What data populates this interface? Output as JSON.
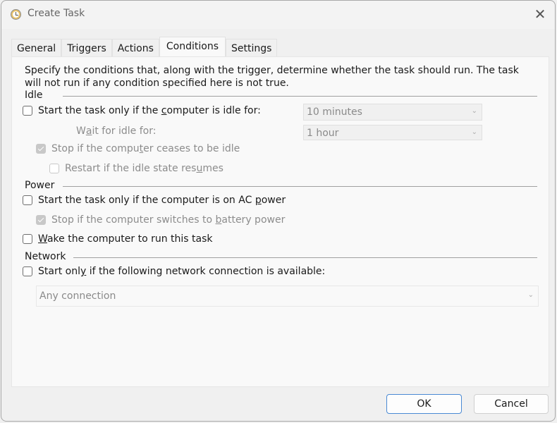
{
  "window": {
    "title": "Create Task",
    "icon": "clock-icon",
    "close_icon": "close-icon",
    "close_glyph": "✕"
  },
  "tabs": [
    {
      "label": "General",
      "active": false
    },
    {
      "label": "Triggers",
      "active": false
    },
    {
      "label": "Actions",
      "active": false
    },
    {
      "label": "Conditions",
      "active": true
    },
    {
      "label": "Settings",
      "active": false
    }
  ],
  "description": "Specify the conditions that, along with the trigger, determine whether the task should run.  The task will not run  if any condition specified here is not true.",
  "idle": {
    "label": "Idle",
    "start_if_idle": {
      "pre": "Start the task only if the ",
      "u": "c",
      "post": "omputer is idle for:",
      "checked": false,
      "enabled": true
    },
    "idle_duration": {
      "value": "10 minutes",
      "enabled": false
    },
    "wait_label": {
      "pre": "W",
      "u": "a",
      "post": "it for idle for:"
    },
    "wait_duration": {
      "value": "1 hour",
      "enabled": false
    },
    "stop_if_ceases": {
      "pre": "Stop if the compu",
      "u": "t",
      "post": "er ceases to be idle",
      "checked": true,
      "enabled": false
    },
    "restart_if_resumes": {
      "pre": "Restart if the idle state res",
      "u": "u",
      "post": "mes",
      "checked": false,
      "enabled": false
    }
  },
  "power": {
    "label": "Power",
    "ac_power": {
      "pre": "Start the task only if the computer is on AC ",
      "u": "p",
      "post": "ower",
      "checked": false,
      "enabled": true
    },
    "stop_battery": {
      "pre": "Stop if the computer switches to ",
      "u": "b",
      "post": "attery power",
      "checked": true,
      "enabled": false
    },
    "wake": {
      "pre": "",
      "u": "W",
      "post": "ake the computer to run this task",
      "checked": false,
      "enabled": true
    }
  },
  "network": {
    "label": "Network",
    "start_only_if": {
      "pre": "Start onl",
      "u": "y",
      "post": " if the following network connection is available:",
      "checked": false,
      "enabled": true
    },
    "connection": {
      "value": "Any connection",
      "enabled": false
    }
  },
  "buttons": {
    "ok": "OK",
    "cancel": "Cancel"
  },
  "chevron_glyph": "⌄"
}
